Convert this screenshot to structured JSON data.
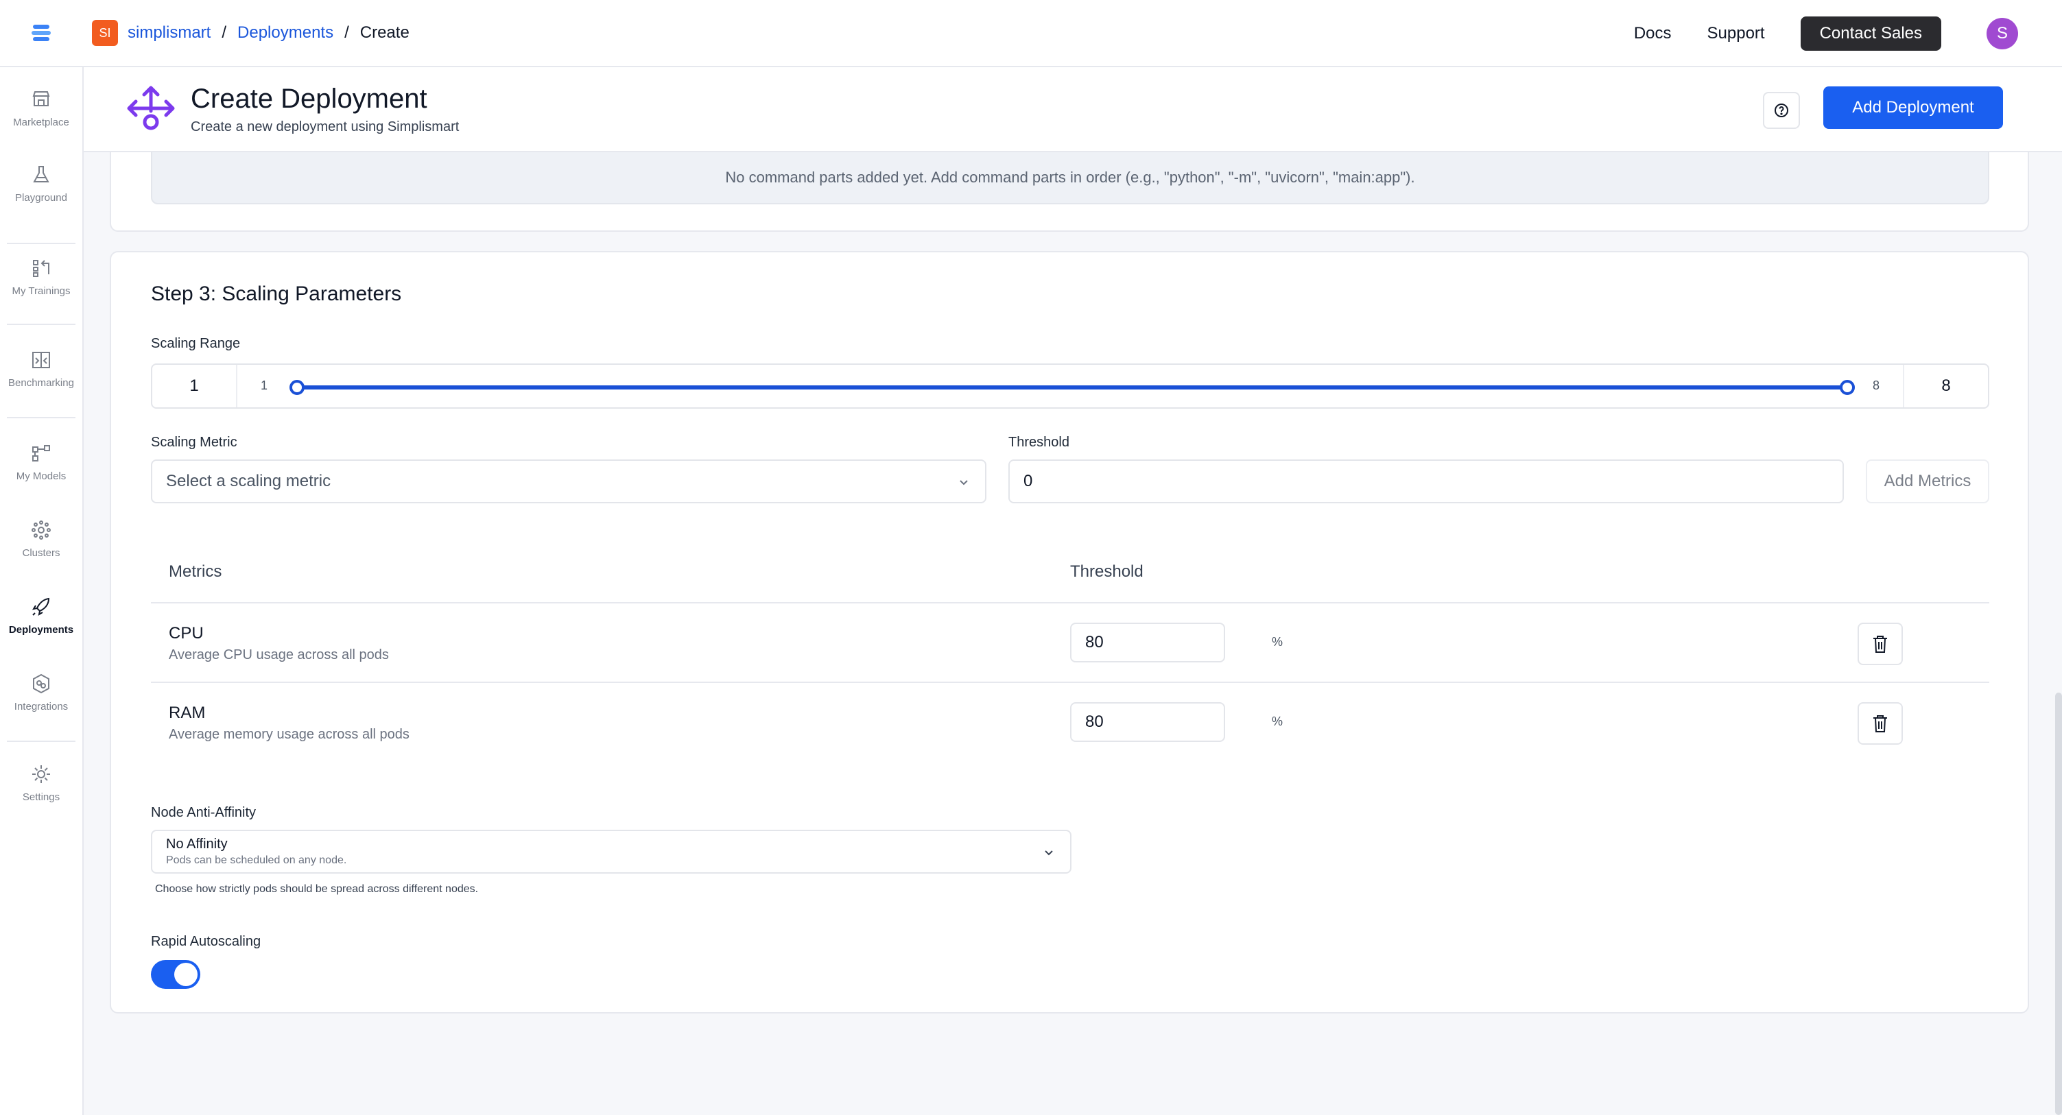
{
  "breadcrumb": {
    "org_badge": "SI",
    "org": "simplismart",
    "section": "Deployments",
    "current": "Create"
  },
  "topnav": {
    "docs": "Docs",
    "support": "Support",
    "contact": "Contact Sales",
    "avatar_initial": "S"
  },
  "sidebar": {
    "items": [
      {
        "label": "Marketplace",
        "icon": "storefront-icon"
      },
      {
        "label": "Playground",
        "icon": "flask-icon"
      },
      {
        "label": "My Trainings",
        "icon": "trainings-icon"
      },
      {
        "label": "Benchmarking",
        "icon": "benchmark-icon"
      },
      {
        "label": "My Models",
        "icon": "models-icon"
      },
      {
        "label": "Clusters",
        "icon": "clusters-icon"
      },
      {
        "label": "Deployments",
        "icon": "rocket-icon",
        "active": true
      },
      {
        "label": "Integrations",
        "icon": "integrations-icon"
      },
      {
        "label": "Settings",
        "icon": "gear-icon"
      }
    ]
  },
  "header": {
    "title": "Create Deployment",
    "subtitle": "Create a new deployment using Simplismart",
    "add_button": "Add Deployment"
  },
  "command": {
    "empty_note": "No command parts added yet. Add command parts in order (e.g., \"python\", \"-m\", \"uvicorn\", \"main:app\")."
  },
  "scaling": {
    "title": "Step 3: Scaling Parameters",
    "range_label": "Scaling Range",
    "range_min": "1",
    "range_max": "8",
    "range_min_tick": "1",
    "range_max_tick": "8",
    "range_values": [
      1,
      8
    ],
    "metric_label": "Scaling Metric",
    "metric_placeholder": "Select a scaling metric",
    "threshold_label": "Threshold",
    "threshold_value": "0",
    "add_metrics": "Add Metrics"
  },
  "metrics_table": {
    "headers": [
      "Metrics",
      "Threshold"
    ],
    "rows": [
      {
        "name": "CPU",
        "description": "Average CPU usage across all pods",
        "threshold": "80",
        "unit": "%"
      },
      {
        "name": "RAM",
        "description": "Average memory usage across all pods",
        "threshold": "80",
        "unit": "%"
      }
    ]
  },
  "affinity": {
    "label": "Node Anti-Affinity",
    "selected": "No Affinity",
    "selected_desc": "Pods can be scheduled on any node.",
    "help": "Choose how strictly pods should be spread across different nodes."
  },
  "autoscale": {
    "label": "Rapid Autoscaling",
    "enabled": true
  },
  "colors": {
    "primary": "#1a5ff0",
    "slider": "#1a50d6",
    "brand_icon": "#7c3aed",
    "org_badge": "#f25c1f"
  }
}
